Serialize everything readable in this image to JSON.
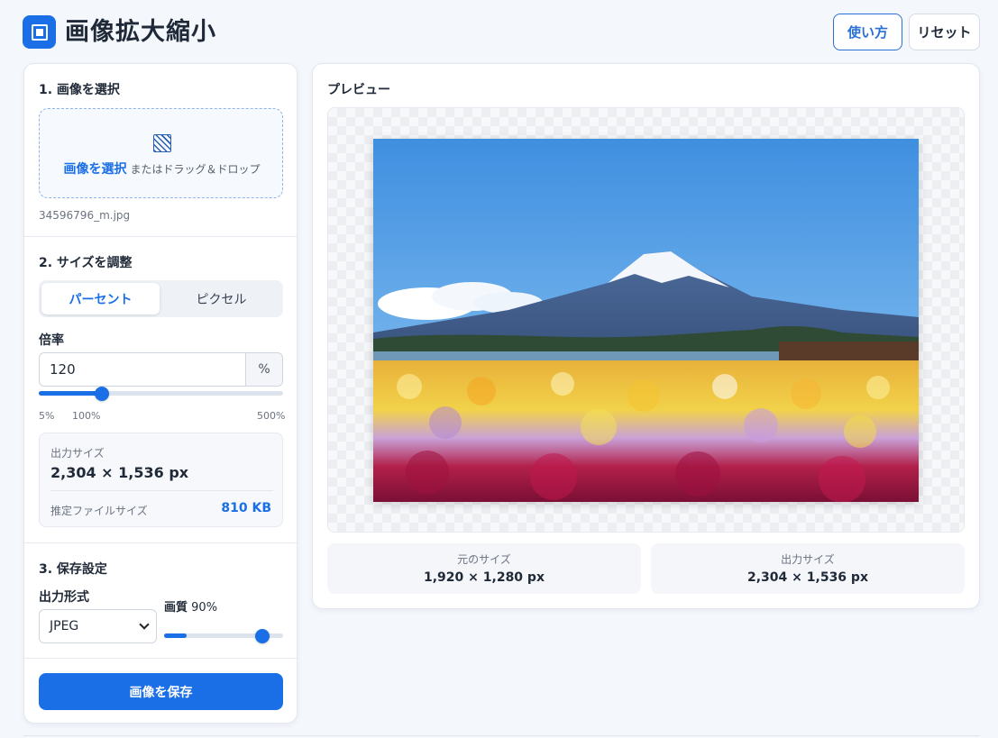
{
  "header": {
    "title": "画像拡大縮小",
    "howto_label": "使い方",
    "reset_label": "リセット"
  },
  "left": {
    "section1": {
      "title": "1. 画像を選択",
      "dropzone_link": "画像を選択",
      "dropzone_sub": "またはドラッグ＆ドロップ",
      "filename": "34596796_m.jpg"
    },
    "section2": {
      "title": "2. サイズを調整",
      "mode_percent": "パーセント",
      "mode_pixel": "ピクセル",
      "scale_label": "倍率",
      "scale_value": "120",
      "scale_unit": "%",
      "scale_percent": 120,
      "tick_min": "5%",
      "tick_mid": "100%",
      "tick_max": "500%",
      "output_label": "出力サイズ",
      "output_size": "2,304 × 1,536 px",
      "est_label": "推定ファイルサイズ",
      "est_value": "810 KB"
    },
    "section3": {
      "title": "3. 保存設定",
      "format_label": "出力形式",
      "format_value": "JPEG",
      "quality_label": "画質",
      "quality_value": "90%",
      "quality_percent": 90
    },
    "save_label": "画像を保存"
  },
  "preview": {
    "title": "プレビュー",
    "original_label": "元のサイズ",
    "original_size": "1,920 × 1,280 px",
    "output_label": "出力サイズ",
    "output_size": "2,304 × 1,536 px"
  },
  "colors": {
    "accent": "#1a6ee6",
    "background": "#f4f7fc"
  }
}
